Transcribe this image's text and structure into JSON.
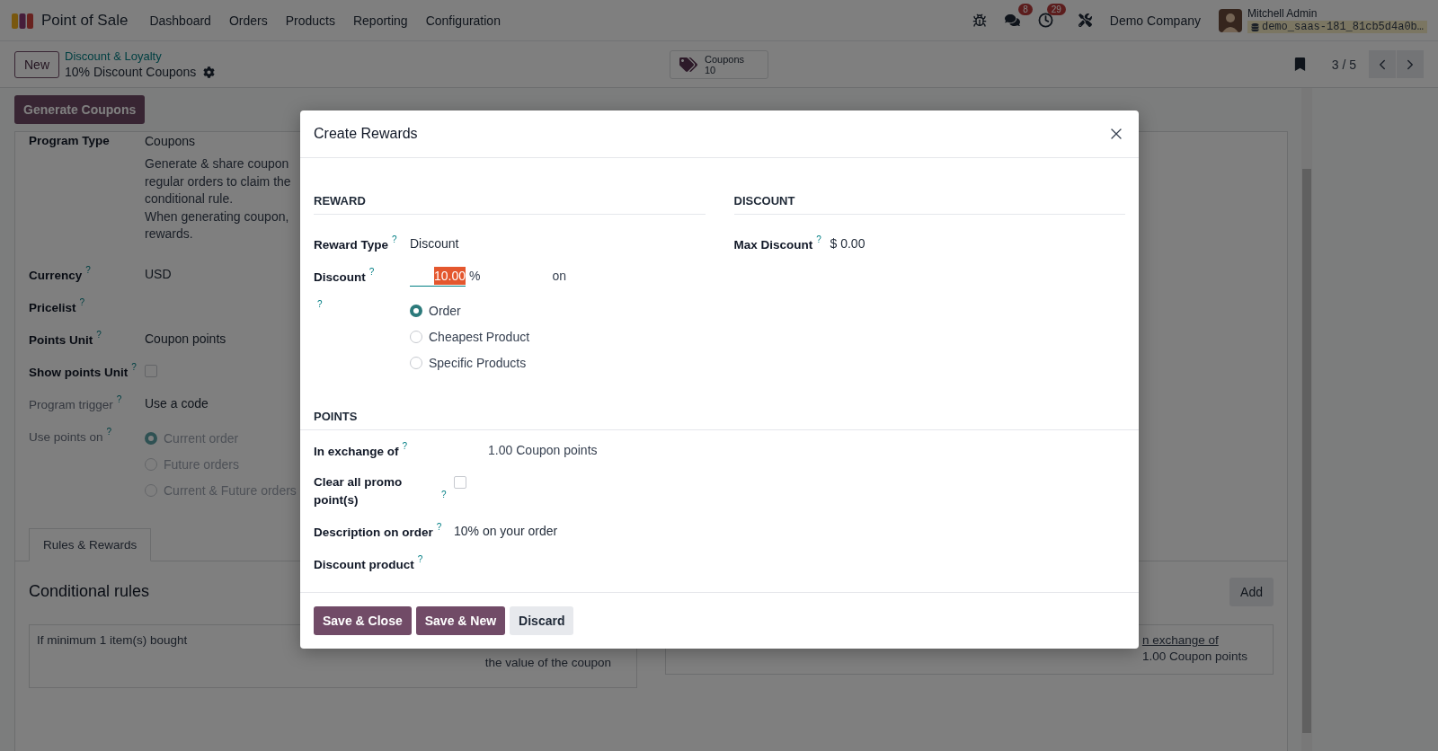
{
  "navbar": {
    "app_name": "Point of Sale",
    "menu": [
      "Dashboard",
      "Orders",
      "Products",
      "Reporting",
      "Configuration"
    ],
    "chat_badge": "8",
    "activity_badge": "29",
    "company": "Demo Company",
    "user_name": "Mitchell Admin",
    "database": "demo_saas-181_81cb5d4a0b…"
  },
  "control_panel": {
    "new_button": "New",
    "breadcrumb": "Discount & Loyalty",
    "record_title": "10% Discount Coupons",
    "stat_button": {
      "label": "Coupons",
      "value": "10"
    },
    "pager": "3 / 5"
  },
  "form": {
    "action_button": "Generate Coupons",
    "fields": [
      {
        "kind": "text",
        "label": "Program Type",
        "value": "Coupons"
      },
      {
        "kind": "paragraph",
        "lines": [
          "Generate & share coupon",
          "regular orders to claim the",
          "conditional rule.",
          "When generating coupon,",
          "rewards."
        ]
      },
      {
        "kind": "text",
        "label": "Currency",
        "help": "?",
        "value": "USD"
      },
      {
        "kind": "text",
        "label": "Pricelist",
        "help": "?"
      },
      {
        "kind": "text",
        "label": "Points Unit",
        "help": "?",
        "value": "Coupon points"
      },
      {
        "kind": "checkbox",
        "label": "Show points Unit",
        "help": "?",
        "checked": false
      },
      {
        "kind": "text",
        "label": "Program trigger",
        "help": "?",
        "disabled": true,
        "value": "Use a code"
      },
      {
        "kind": "radio",
        "label": "Use points on",
        "help": "?",
        "disabled": true,
        "options": [
          {
            "label": "Current order",
            "selected": true
          },
          {
            "label": "Future orders",
            "selected": false
          },
          {
            "label": "Current & Future orders",
            "selected": false
          }
        ]
      }
    ]
  },
  "notebook": {
    "tabs": [
      {
        "label": "Rules & Rewards",
        "selected": true
      }
    ],
    "title": "Conditional rules",
    "add_button": "Add",
    "rule_cards": [
      {
        "text": "If minimum 1 item(s) bought",
        "note": "the value of the coupon"
      }
    ],
    "reward_cards": [
      {
        "link": "n exchange of",
        "text": "1.00 Coupon points"
      }
    ]
  },
  "dialog": {
    "title": "Create Rewards",
    "sections": [
      {
        "title": "REWARD",
        "full_width": false,
        "fields": [
          {
            "kind": "text",
            "label": "Reward Type",
            "help": "?",
            "value": "Discount"
          },
          {
            "kind": "discount",
            "label": "Discount",
            "help": "?",
            "value": "10.00",
            "text_selected": true,
            "unit": "%",
            "suffix": "on"
          },
          {
            "kind": "radio",
            "help": "?",
            "options": [
              {
                "label": "Order",
                "selected": true
              },
              {
                "label": "Cheapest Product",
                "selected": false
              },
              {
                "label": "Specific Products",
                "selected": false
              }
            ]
          }
        ]
      },
      {
        "title": "DISCOUNT",
        "full_width": false,
        "fields": [
          {
            "kind": "text",
            "label": "Max Discount",
            "help": "?",
            "value": "$ 0.00"
          }
        ]
      },
      {
        "title": "POINTS",
        "full_width": true,
        "fields": [
          {
            "kind": "quantity",
            "label": "In exchange of",
            "help": "?",
            "value": "1.00",
            "unit": "Coupon points"
          },
          {
            "kind": "checkbox",
            "label": "Clear all promo point(s)",
            "help": "?",
            "checked": false
          },
          {
            "kind": "text",
            "label": "Description on order",
            "help": "?",
            "value": "10% on your order"
          },
          {
            "kind": "text",
            "label": "Discount product",
            "help": "?"
          }
        ]
      }
    ],
    "buttons": [
      {
        "label": "Save & Close",
        "kind": "primary"
      },
      {
        "label": "Save & New",
        "kind": "primary"
      },
      {
        "label": "Discard",
        "kind": "secondary"
      }
    ]
  }
}
